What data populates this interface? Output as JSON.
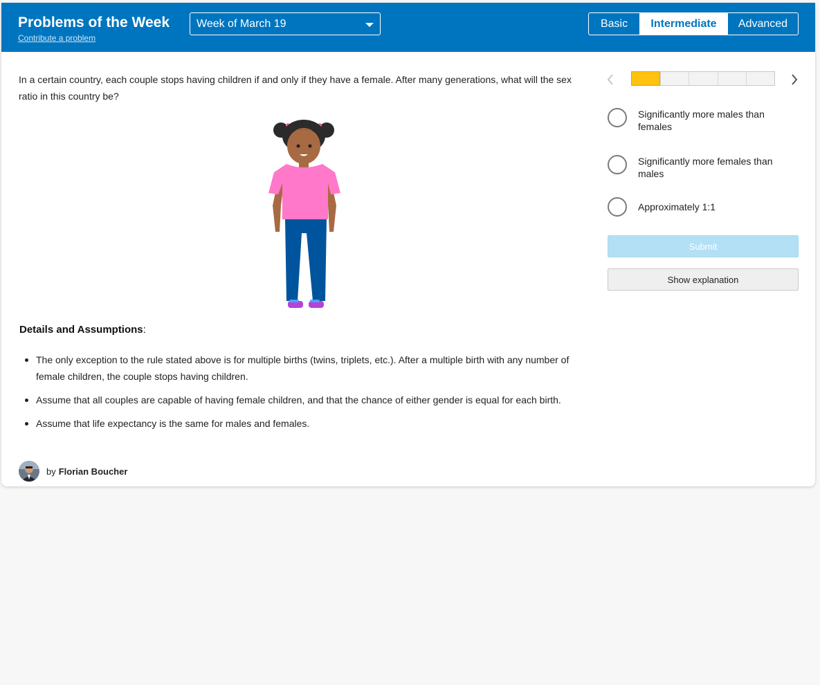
{
  "header": {
    "title": "Problems of the Week",
    "contribute_link": "Contribute a problem",
    "week_select": {
      "selected": "Week of March 19"
    },
    "levels": [
      {
        "label": "Basic",
        "active": false
      },
      {
        "label": "Intermediate",
        "active": true
      },
      {
        "label": "Advanced",
        "active": false
      }
    ]
  },
  "problem": {
    "question": "In a certain country, each couple stops having children if and only if they have a female. After many generations, what will the sex ratio in this country be?",
    "illustration": "girl-illustration",
    "details_heading": "Details and Assumptions",
    "details_suffix": ":",
    "details": [
      "The only exception to the rule stated above is for multiple births (twins, triplets, etc.). After a multiple birth with any number of female children, the couple stops having children.",
      "Assume that all couples are capable of having female children, and that the chance of either gender is equal for each birth.",
      "Assume that life expectancy is the same for males and females."
    ],
    "author_prefix": "by",
    "author_name": "Florian Boucher"
  },
  "answer_panel": {
    "progress": {
      "current": 1,
      "total": 5
    },
    "options": [
      "Significantly more males than females",
      "Significantly more females than males",
      "Approximately 1:1"
    ],
    "submit_label": "Submit",
    "explanation_label": "Show explanation"
  },
  "colors": {
    "header_bg": "#0075bf",
    "progress_fill": "#ffc20e",
    "submit_disabled": "#b3e0f5"
  }
}
